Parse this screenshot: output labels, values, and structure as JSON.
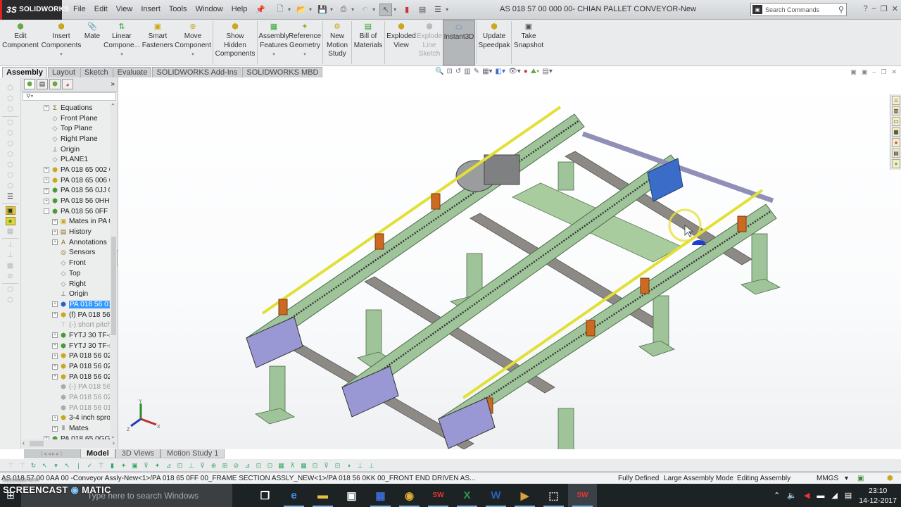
{
  "app": {
    "name": "SOLIDWORKS",
    "logo_prefix": "3S"
  },
  "menu": [
    "File",
    "Edit",
    "View",
    "Insert",
    "Tools",
    "Window",
    "Help"
  ],
  "document_title": "AS 018 57 00 000 00- CHIAN PALLET CONVEYOR-New",
  "search": {
    "placeholder": "Search Commands"
  },
  "command_manager": {
    "commands": [
      {
        "label": "Edit Component",
        "icon": "edit-component-icon",
        "dropdown": false
      },
      {
        "label": "Insert Components",
        "icon": "insert-components-icon",
        "dropdown": true
      },
      {
        "label": "Mate",
        "icon": "mate-icon",
        "dropdown": false
      },
      {
        "label": "Linear Compone...",
        "icon": "linear-pattern-icon",
        "dropdown": true
      },
      {
        "label": "Smart Fasteners",
        "icon": "smart-fasteners-icon",
        "dropdown": false
      },
      {
        "label": "Move Component",
        "icon": "move-component-icon",
        "dropdown": true
      },
      {
        "label": "Show Hidden Components",
        "icon": "show-hidden-icon",
        "dropdown": false
      },
      {
        "label": "Assembly Features",
        "icon": "assembly-features-icon",
        "dropdown": true
      },
      {
        "label": "Reference Geometry",
        "icon": "reference-geometry-icon",
        "dropdown": true
      },
      {
        "label": "New Motion Study",
        "icon": "motion-study-icon",
        "dropdown": false
      },
      {
        "label": "Bill of Materials",
        "icon": "bom-icon",
        "dropdown": false
      },
      {
        "label": "Exploded View",
        "icon": "exploded-view-icon",
        "dropdown": false
      },
      {
        "label": "Explode Line Sketch",
        "icon": "explode-line-icon",
        "dropdown": false,
        "disabled": true
      },
      {
        "label": "Instant3D",
        "icon": "instant3d-icon",
        "dropdown": false,
        "active": true
      },
      {
        "label": "Update Speedpak",
        "icon": "speedpak-icon",
        "dropdown": false
      },
      {
        "label": "Take Snapshot",
        "icon": "snapshot-icon",
        "dropdown": false
      }
    ],
    "tabs": [
      "Assembly",
      "Layout",
      "Sketch",
      "Evaluate",
      "SOLIDWORKS Add-Ins",
      "SOLIDWORKS MBD"
    ],
    "active_tab": "Assembly"
  },
  "feature_tree": {
    "nodes": [
      {
        "label": "Equations",
        "icon": "equations-icon",
        "expander": "+",
        "indent": 0
      },
      {
        "label": "Front Plane",
        "icon": "plane-icon",
        "expander": "",
        "indent": 0
      },
      {
        "label": "Top Plane",
        "icon": "plane-icon",
        "expander": "",
        "indent": 0
      },
      {
        "label": "Right Plane",
        "icon": "plane-icon",
        "expander": "",
        "indent": 0
      },
      {
        "label": "Origin",
        "icon": "origin-icon",
        "expander": "",
        "indent": 0
      },
      {
        "label": "PLANE1",
        "icon": "plane-icon",
        "expander": "",
        "indent": 0
      },
      {
        "label": "PA 018 65 002 0",
        "icon": "part-icon",
        "expander": "+",
        "indent": 0
      },
      {
        "label": "PA 018 65 006 0",
        "icon": "part-icon",
        "expander": "+",
        "indent": 0
      },
      {
        "label": "PA 018 56 0JJ 0(",
        "icon": "subassembly-icon",
        "expander": "+",
        "indent": 0
      },
      {
        "label": "PA 018 56 0HH",
        "icon": "subassembly-icon",
        "expander": "+",
        "indent": 0
      },
      {
        "label": "PA 018 56 0FF 0",
        "icon": "subassembly-icon",
        "expander": "-",
        "indent": 0
      },
      {
        "label": "Mates in PA 0",
        "icon": "mates-folder-icon",
        "expander": "+",
        "indent": 1
      },
      {
        "label": "History",
        "icon": "history-icon",
        "expander": "+",
        "indent": 1
      },
      {
        "label": "Annotations",
        "icon": "annotations-icon",
        "expander": "+",
        "indent": 1
      },
      {
        "label": "Sensors",
        "icon": "sensors-icon",
        "expander": "",
        "indent": 1
      },
      {
        "label": "Front",
        "icon": "plane-icon",
        "expander": "",
        "indent": 1
      },
      {
        "label": "Top",
        "icon": "plane-icon",
        "expander": "",
        "indent": 1
      },
      {
        "label": "Right",
        "icon": "plane-icon",
        "expander": "",
        "indent": 1
      },
      {
        "label": "Origin",
        "icon": "origin-icon",
        "expander": "",
        "indent": 1
      },
      {
        "label": "PA 018 56 01",
        "icon": "part-icon",
        "expander": "+",
        "indent": 1,
        "selected": true
      },
      {
        "label": "(f) PA 018 56",
        "icon": "part-icon",
        "expander": "+",
        "indent": 1
      },
      {
        "label": "(-) short pitch",
        "icon": "toolbox-part-icon",
        "expander": "",
        "indent": 1,
        "suppressed": true
      },
      {
        "label": "FYTJ 30 TF-st",
        "icon": "subassembly-icon",
        "expander": "+",
        "indent": 1
      },
      {
        "label": "FYTJ 30 TF-st",
        "icon": "subassembly-icon",
        "expander": "+",
        "indent": 1
      },
      {
        "label": "PA 018 56 02",
        "icon": "part-icon",
        "expander": "+",
        "indent": 1
      },
      {
        "label": "PA 018 56 02",
        "icon": "part-icon",
        "expander": "+",
        "indent": 1
      },
      {
        "label": "PA 018 56 02",
        "icon": "part-icon",
        "expander": "+",
        "indent": 1
      },
      {
        "label": "(-) PA 018 56",
        "icon": "part-icon",
        "expander": "",
        "indent": 1,
        "suppressed": true
      },
      {
        "label": "PA 018 56 02",
        "icon": "part-icon",
        "expander": "",
        "indent": 1,
        "suppressed": true
      },
      {
        "label": "PA 018 56 01",
        "icon": "part-icon",
        "expander": "",
        "indent": 1,
        "suppressed": true
      },
      {
        "label": "3-4 inch spro",
        "icon": "part-icon",
        "expander": "+",
        "indent": 1
      },
      {
        "label": "Mates",
        "icon": "mates-icon",
        "expander": "+",
        "indent": 1
      },
      {
        "label": "PA 018 65 0GG (",
        "icon": "subassembly-icon",
        "expander": "+",
        "indent": 0
      }
    ]
  },
  "bottom_tabs": [
    "Model",
    "3D Views",
    "Motion Study 1"
  ],
  "active_bottom_tab": "Model",
  "status_bar": {
    "path": "AS 018 57 00 0AA 00 -Conveyor Assly-New<1>/PA 018 65 0FF 00_FRAME SECTION ASSLY_NEW<1>/PA 018 56 0KK 00_FRONT END  DRIVEN AS...",
    "definition": "Fully Defined",
    "mode": "Large Assembly Mode",
    "editing": "Editing Assembly",
    "units": "MMGS"
  },
  "triad": {
    "x": "X",
    "y": "Y",
    "z": "Z"
  },
  "taskbar": {
    "search_text": "Type here to search Windows",
    "watermark": "SCREENCAST",
    "watermark2": "MATIC",
    "watermark_small": "RECORDED WITH",
    "apps": [
      {
        "name": "task-view",
        "glyph": "❐"
      },
      {
        "name": "edge",
        "glyph": "e"
      },
      {
        "name": "file-explorer",
        "glyph": "▬"
      },
      {
        "name": "store",
        "glyph": "▣"
      },
      {
        "name": "calculator",
        "glyph": "▦"
      },
      {
        "name": "chrome",
        "glyph": "◉"
      },
      {
        "name": "solidworks-2016",
        "glyph": "SW"
      },
      {
        "name": "excel",
        "glyph": "X"
      },
      {
        "name": "word",
        "glyph": "W"
      },
      {
        "name": "media",
        "glyph": "▶"
      },
      {
        "name": "snipping",
        "glyph": "⬚"
      },
      {
        "name": "solidworks",
        "glyph": "SW"
      }
    ],
    "time": "23:10",
    "date": "14-12-2017"
  },
  "colors": {
    "frame_green": "#9fc49a",
    "rail_gray": "#8d8a86",
    "guide_yellow": "#e2e036",
    "bracket_orange": "#cc6a22",
    "plate_blue": "#3a6cc8",
    "selection_blue": "#3399ff"
  }
}
